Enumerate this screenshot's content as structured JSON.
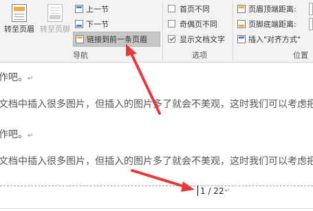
{
  "ribbon": {
    "goto_header": "转至页眉",
    "goto_footer": "转至页脚",
    "previous_section": "上一节",
    "next_section": "下一节",
    "link_to_previous": "链接到前一条页眉",
    "nav_group": "导航",
    "options": {
      "different_first_page": {
        "label": "首页不同",
        "checked": false
      },
      "different_odd_even": {
        "label": "奇偶页不同",
        "checked": false
      },
      "show_document_text": {
        "label": "显示文档文字",
        "checked": true
      }
    },
    "options_group": "选项",
    "header_top_distance": "页眉顶端距离:",
    "footer_bottom_distance": "页脚底端距离:",
    "insert_align_tab": "插入\"对齐方式\"",
    "position_group": "位置"
  },
  "document": {
    "lines": [
      "作吧。",
      "文档中插入很多图片，但插入的图片多了就会不美观，这时我们可以考虑把",
      "作吧。",
      "文档中插入很多图片，但插入的图片多了就会不美观，这时我们可以考虑把"
    ],
    "paragraph_mark": "↵",
    "page_number": "1 / 22"
  },
  "colors": {
    "ribbon_bg": "#f3f3f3",
    "highlight": "#c6c6c6",
    "arrow": "#e8393a"
  }
}
